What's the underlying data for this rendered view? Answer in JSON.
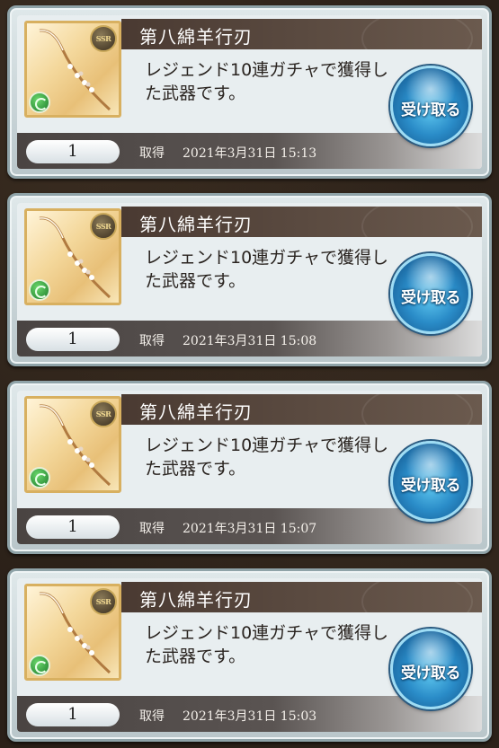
{
  "items": [
    {
      "title": "第八綿羊行刃",
      "description": "レジェンド10連ガチャで獲得した武器です。",
      "rarity": "SSR",
      "element_icon": "wind-element-icon",
      "quantity": "1",
      "acquired_label": "取得",
      "acquired_datetime": "2021年3月31日  15:13",
      "receive_label": "受け取る"
    },
    {
      "title": "第八綿羊行刃",
      "description": "レジェンド10連ガチャで獲得した武器です。",
      "rarity": "SSR",
      "element_icon": "wind-element-icon",
      "quantity": "1",
      "acquired_label": "取得",
      "acquired_datetime": "2021年3月31日  15:08",
      "receive_label": "受け取る"
    },
    {
      "title": "第八綿羊行刃",
      "description": "レジェンド10連ガチャで獲得した武器です。",
      "rarity": "SSR",
      "element_icon": "wind-element-icon",
      "quantity": "1",
      "acquired_label": "取得",
      "acquired_datetime": "2021年3月31日  15:07",
      "receive_label": "受け取る"
    },
    {
      "title": "第八綿羊行刃",
      "description": "レジェンド10連ガチャで獲得した武器です。",
      "rarity": "SSR",
      "element_icon": "wind-element-icon",
      "quantity": "1",
      "acquired_label": "取得",
      "acquired_datetime": "2021年3月31日  15:03",
      "receive_label": "受け取る"
    }
  ],
  "colors": {
    "title_bar": "#4a3a32",
    "receive_button": "#2a8cc8",
    "card_frame": "#8fa3a8",
    "rarity_gold": "#c9a85a",
    "wind_green": "#1a7a2a"
  }
}
